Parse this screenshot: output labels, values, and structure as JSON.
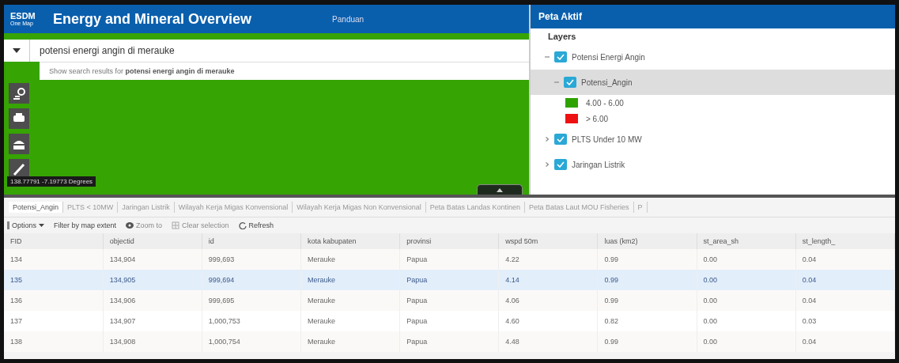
{
  "header": {
    "logo_text": "ESDM",
    "logo_sub": "One Map",
    "title": "Energy and Mineral Overview",
    "link": "Panduan"
  },
  "search": {
    "value": "potensi energi angin di merauke",
    "suggestion": "Show search results for **potensi energi angin di merauke**"
  },
  "map": {
    "coordinates": "138.77791 -7.19773 Degrees"
  },
  "panel": {
    "title": "Peta Aktif",
    "section": "Layers",
    "layers": [
      {
        "label": "Potensi Energi Angin",
        "checked": true,
        "expanded": true,
        "selected": false,
        "children": [
          {
            "label": "Potensi_Angin",
            "checked": true,
            "expanded": true,
            "selected": true,
            "legend": [
              {
                "label": "4.00 - 6.00",
                "color": "#2ea200"
              },
              {
                "label": "> 6.00",
                "color": "#ee1111"
              }
            ]
          }
        ]
      },
      {
        "label": "PLTS Under 10 MW",
        "checked": true,
        "expanded": false,
        "selected": false
      },
      {
        "label": "Jaringan Listrik",
        "checked": true,
        "expanded": false,
        "selected": false
      }
    ]
  },
  "table": {
    "tabs": [
      {
        "label": "Potensi_Angin",
        "selected": true
      },
      {
        "label": "PLTS < 10MW",
        "selected": false
      },
      {
        "label": "Jaringan Listrik",
        "selected": false
      },
      {
        "label": "Wilayah Kerja Migas Konvensional",
        "selected": false
      },
      {
        "label": "Wilayah Kerja Migas Non Konvensional",
        "selected": false
      },
      {
        "label": "Peta Batas Landas Kontinen",
        "selected": false
      },
      {
        "label": "Peta Batas Laut MOU Fisheries",
        "selected": false
      },
      {
        "label": "P",
        "selected": false
      }
    ],
    "toolbar": [
      {
        "kind": "menu",
        "label": "Options"
      },
      {
        "kind": "plain",
        "label": "Filter by map extent"
      },
      {
        "kind": "zoom",
        "label": "Zoom to",
        "disabled": true
      },
      {
        "kind": "clear",
        "label": "Clear selection",
        "disabled": true
      },
      {
        "kind": "refresh",
        "label": "Refresh"
      }
    ],
    "columns": [
      "FID",
      "objectid",
      "id",
      "kota kabupaten",
      "provinsi",
      "wspd 50m",
      "luas (km2)",
      "st_area_sh",
      "st_length_"
    ],
    "rows": [
      {
        "selected": false,
        "cells": [
          "134",
          "134,904",
          "999,693",
          "Merauke",
          "Papua",
          "4.22",
          "0.99",
          "0.00",
          "0.04"
        ]
      },
      {
        "selected": true,
        "cells": [
          "135",
          "134,905",
          "999,694",
          "Merauke",
          "Papua",
          "4.14",
          "0.99",
          "0.00",
          "0.04"
        ]
      },
      {
        "selected": false,
        "cells": [
          "136",
          "134,906",
          "999,695",
          "Merauke",
          "Papua",
          "4.06",
          "0.99",
          "0.00",
          "0.04"
        ]
      },
      {
        "selected": false,
        "cells": [
          "137",
          "134,907",
          "1,000,753",
          "Merauke",
          "Papua",
          "4.60",
          "0.82",
          "0.00",
          "0.03"
        ]
      },
      {
        "selected": false,
        "cells": [
          "138",
          "134,908",
          "1,000,754",
          "Merauke",
          "Papua",
          "4.48",
          "0.99",
          "0.00",
          "0.04"
        ]
      }
    ]
  }
}
